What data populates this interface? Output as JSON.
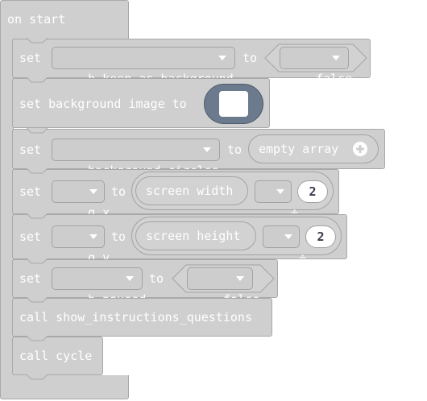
{
  "event_block": {
    "label": "on start"
  },
  "rows": [
    {
      "keyword": "set",
      "variable": "b_keep_as_background",
      "to": "to",
      "value": "false"
    },
    {
      "keyword": "set background image to"
    },
    {
      "keyword": "set",
      "variable": "background_circles",
      "to": "to",
      "value": "empty array"
    },
    {
      "keyword": "set",
      "variable": "g_x",
      "to": "to",
      "operand": "screen width",
      "operator": "÷",
      "number": "2"
    },
    {
      "keyword": "set",
      "variable": "g_y",
      "to": "to",
      "operand": "screen height",
      "operator": "÷",
      "number": "2"
    },
    {
      "keyword": "set",
      "variable": "b_paused",
      "to": "to",
      "value": "false"
    },
    {
      "keyword": "call show_instructions_questions"
    },
    {
      "keyword": "call cycle"
    }
  ],
  "icons": {
    "add": "plus-circle-icon",
    "dropdown": "chevron-down-icon",
    "image": "image-thumbnail"
  },
  "colors": {
    "block": "#cfcfcf",
    "border": "#a9a9a9",
    "text": "#ffffff",
    "image_bg": "#6b7a8c",
    "number_text": "#3a3a4a"
  }
}
